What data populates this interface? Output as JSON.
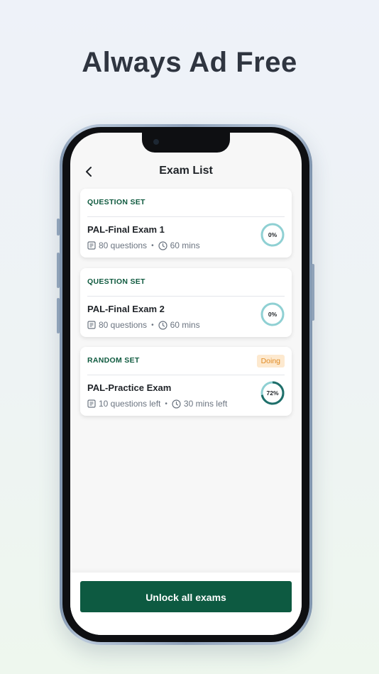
{
  "headline": "Always Ad Free",
  "nav": {
    "title": "Exam List"
  },
  "exams": [
    {
      "type": "QUESTION SET",
      "title": "PAL-Final Exam 1",
      "questions": "80 questions",
      "time": "60 mins",
      "progress_label": "0%",
      "progress": 0
    },
    {
      "type": "QUESTION SET",
      "title": "PAL-Final Exam 2",
      "questions": "80 questions",
      "time": "60 mins",
      "progress_label": "0%",
      "progress": 0
    },
    {
      "type": "RANDOM SET",
      "badge": "Doing",
      "title": "PAL-Practice Exam",
      "questions": "10 questions left",
      "time": "30 mins left",
      "progress_label": "72%",
      "progress": 0.72
    }
  ],
  "meta_separator": "•",
  "unlock_label": "Unlock all exams",
  "colors": {
    "accent": "#0d5a41",
    "ring_track": "#8fd0d3",
    "ring_fill": "#1f6f6a",
    "badge_bg": "#fde9cf",
    "badge_text": "#e08a22"
  }
}
